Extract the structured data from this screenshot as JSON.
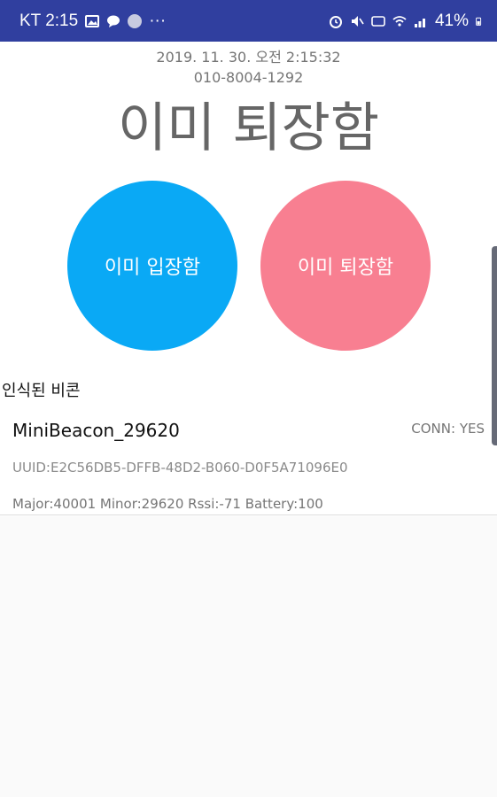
{
  "status_bar": {
    "carrier_time": "KT 2:15",
    "more": "···",
    "battery": "41%"
  },
  "header": {
    "datetime": "2019. 11. 30. 오전 2:15:32",
    "phone": "010-8004-1292",
    "title": "이미 퇴장함"
  },
  "buttons": {
    "enter": "이미 입장함",
    "exit": "이미 퇴장함"
  },
  "section": {
    "label": "인식된 비콘"
  },
  "beacon": {
    "name": "MiniBeacon_29620",
    "conn": "CONN: YES",
    "uuid": "UUID:E2C56DB5-DFFB-48D2-B060-D0F5A71096E0",
    "details": "Major:40001 Minor:29620 Rssi:-71 Battery:100"
  },
  "colors": {
    "status_bar": "#303f9f",
    "enter_button": "#0aa9f5",
    "exit_button": "#f87f91"
  }
}
